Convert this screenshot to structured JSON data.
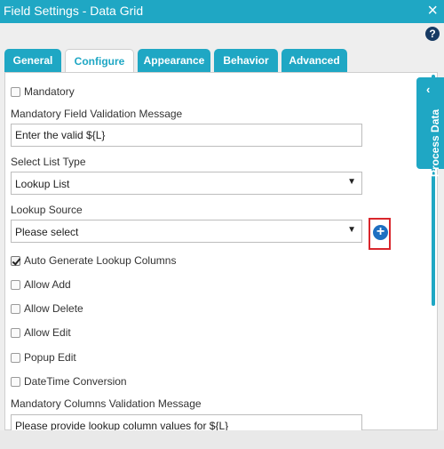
{
  "window": {
    "title": "Field Settings - Data Grid",
    "close_label": "×"
  },
  "help": {
    "label": "?"
  },
  "tabs": [
    {
      "label": "General"
    },
    {
      "label": "Configure"
    },
    {
      "label": "Appearance"
    },
    {
      "label": "Behavior"
    },
    {
      "label": "Advanced"
    }
  ],
  "form": {
    "mandatory_label": "Mandatory",
    "validation_message_label": "Mandatory Field Validation Message",
    "validation_message_value": "Enter the valid ${L}",
    "select_list_type_label": "Select List Type",
    "select_list_type_value": "Lookup List",
    "lookup_source_label": "Lookup Source",
    "lookup_source_value": "Please select",
    "auto_generate_label": "Auto Generate Lookup Columns",
    "allow_add_label": "Allow Add",
    "allow_delete_label": "Allow Delete",
    "allow_edit_label": "Allow Edit",
    "popup_edit_label": "Popup Edit",
    "datetime_conversion_label": "DateTime Conversion",
    "columns_validation_label": "Mandatory Columns Validation Message",
    "columns_validation_value": "Please provide lookup column values for ${L}"
  },
  "checks": {
    "mandatory": false,
    "auto_generate": true,
    "allow_add": false,
    "allow_delete": false,
    "allow_edit": false,
    "popup_edit": false,
    "datetime_conversion": false
  },
  "process_data": {
    "label": "Process Data",
    "chevron": "‹"
  },
  "add_button": {
    "label": "+"
  },
  "colors": {
    "accent": "#1fa7c4",
    "help": "#173a63",
    "add": "#1e6fc1",
    "highlight": "#d9262c"
  }
}
